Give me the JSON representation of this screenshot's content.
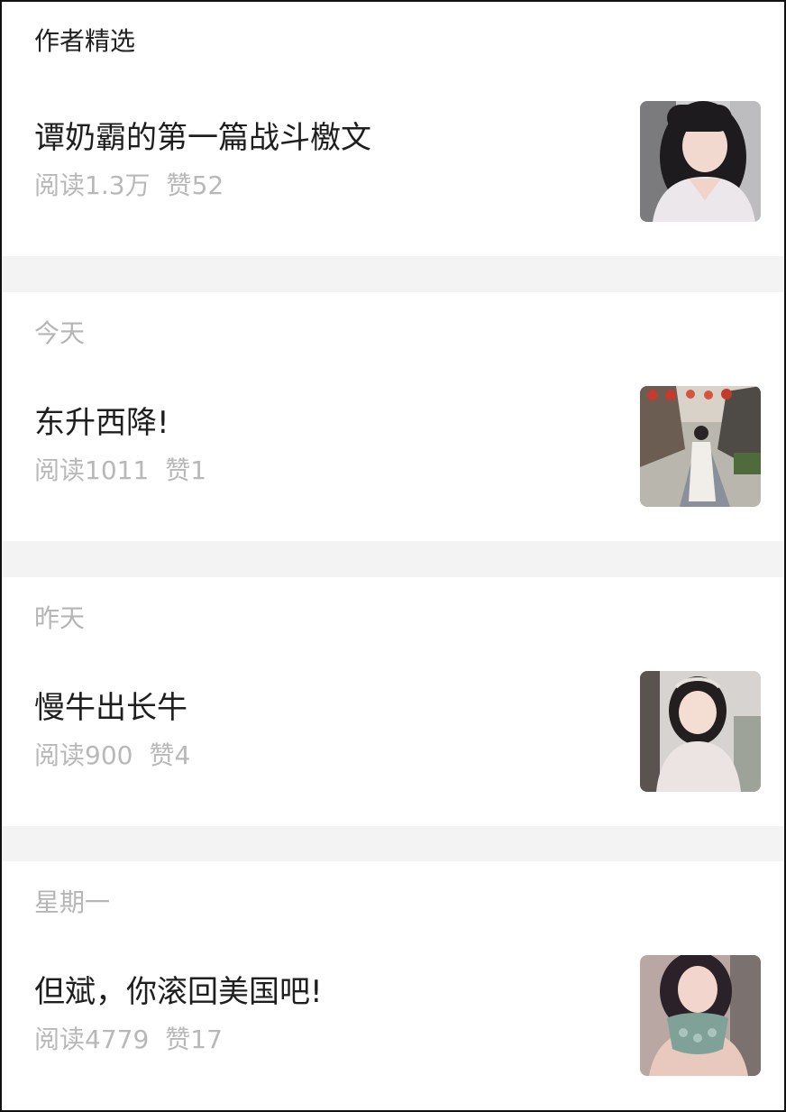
{
  "featured": {
    "label": "作者精选",
    "article": {
      "title": "谭奶霸的第一篇战斗檄文",
      "reads_label": "阅读",
      "reads": "1.3万",
      "likes_label": "赞",
      "likes": "52",
      "thumb_icon": "photo-woman-portrait"
    }
  },
  "groups": [
    {
      "date": "今天",
      "article": {
        "title": "东升西降!",
        "reads_label": "阅读",
        "reads": "1011",
        "likes_label": "赞",
        "likes": "1",
        "thumb_icon": "photo-street-scene"
      }
    },
    {
      "date": "昨天",
      "article": {
        "title": "慢牛出长牛",
        "reads_label": "阅读",
        "reads": "900",
        "likes_label": "赞",
        "likes": "4",
        "thumb_icon": "photo-girl-portrait"
      }
    },
    {
      "date": "星期一",
      "article": {
        "title": "但斌，你滚回美国吧!",
        "reads_label": "阅读",
        "reads": "4779",
        "likes_label": "赞",
        "likes": "17",
        "thumb_icon": "photo-woman-lace"
      }
    }
  ]
}
